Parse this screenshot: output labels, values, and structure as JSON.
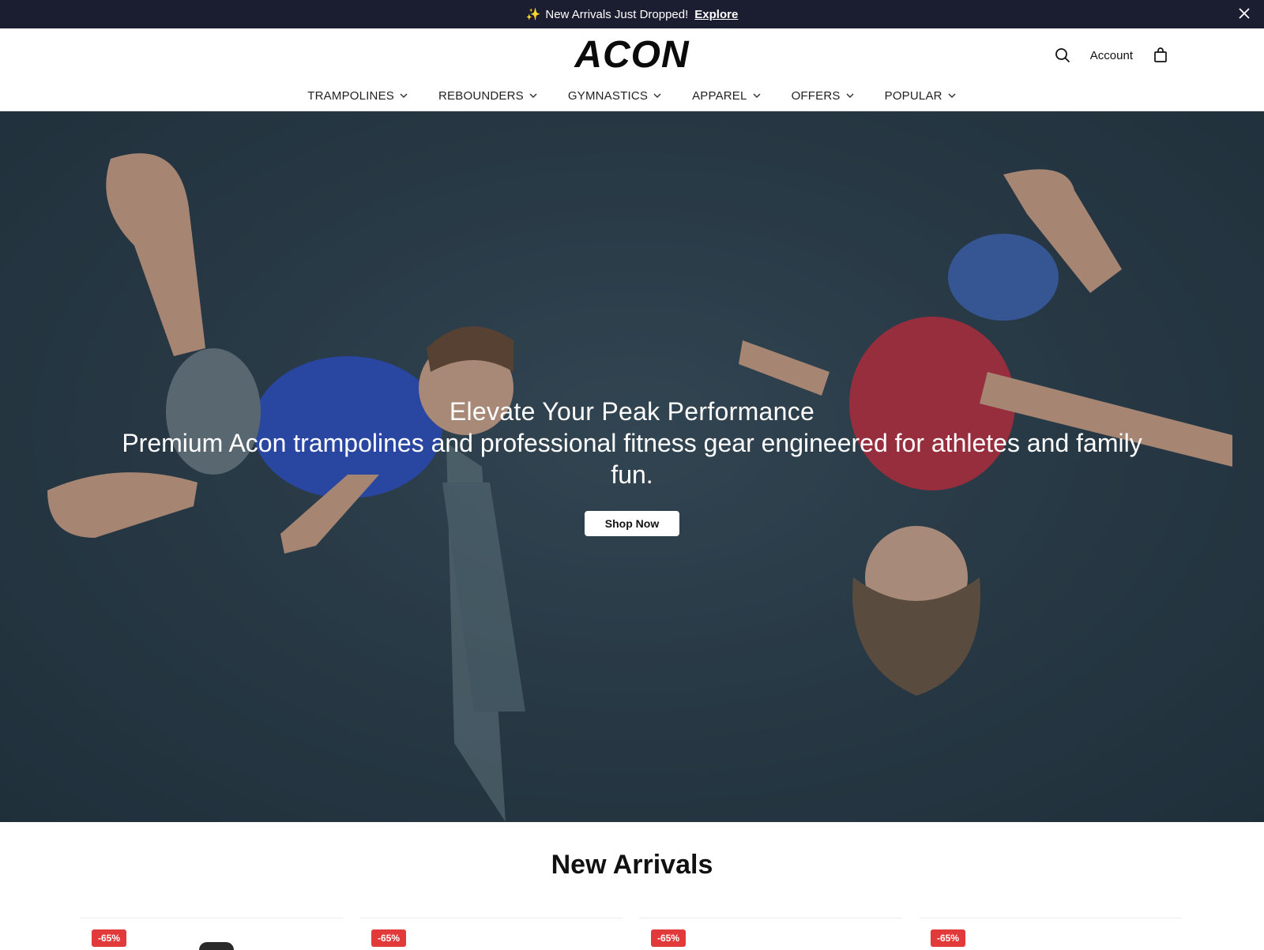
{
  "announcement": {
    "sparkle": "✨",
    "text": "New Arrivals Just Dropped!",
    "link": "Explore"
  },
  "header": {
    "logo_text": "ACON",
    "account": "Account",
    "icons": [
      "search-icon",
      "bag-icon"
    ]
  },
  "nav": {
    "items": [
      {
        "label": "TRAMPOLINES"
      },
      {
        "label": "REBOUNDERS"
      },
      {
        "label": "GYMNASTICS"
      },
      {
        "label": "APPAREL"
      },
      {
        "label": "OFFERS"
      },
      {
        "label": "POPULAR"
      }
    ]
  },
  "hero": {
    "title": "Elevate Your Peak Performance",
    "subtitle": "Premium Acon trampolines and professional fitness gear engineered for athletes and family fun.",
    "cta": "Shop Now"
  },
  "new_arrivals": {
    "title": "New Arrivals",
    "cards": [
      {
        "badge": "-65%"
      },
      {
        "badge": "-65%"
      },
      {
        "badge": "-65%"
      },
      {
        "badge": "-65%"
      }
    ]
  },
  "colors": {
    "announcement_bg": "#1b1d31",
    "badge": "#e23a3a",
    "hero_bg": "#2e404c"
  }
}
